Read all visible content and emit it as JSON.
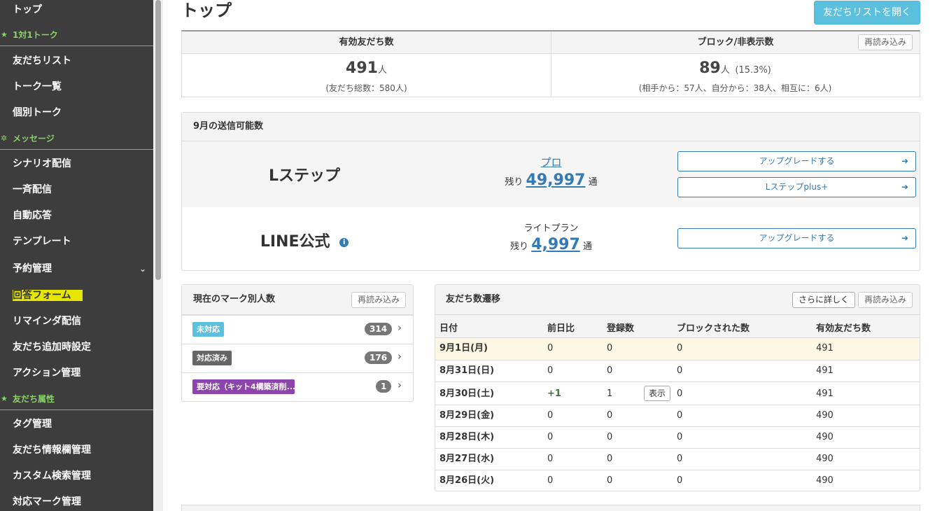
{
  "sidebar": {
    "top": "トップ",
    "sections": [
      {
        "title": "1対1トーク",
        "icon": "star-icon"
      },
      {
        "title": "メッセージ",
        "icon": "broadcast-icon"
      },
      {
        "title": "友だち属性",
        "icon": "star-icon"
      }
    ],
    "items": [
      "友だちリスト",
      "トーク一覧",
      "個別トーク",
      "シナリオ配信",
      "一斉配信",
      "自動応答",
      "テンプレート",
      "予約管理",
      "回答フォーム",
      "リマインダ配信",
      "友だち追加時設定",
      "アクション管理",
      "タグ管理",
      "友だち情報欄管理",
      "カスタム検索管理",
      "対応マーク管理"
    ],
    "active_item": "回答フォーム"
  },
  "header": {
    "title": "トップ",
    "open_friends_list": "友だちリストを開く"
  },
  "stats": {
    "valid_label": "有効友だち数",
    "valid_count": "491",
    "unit": "人",
    "valid_sub": "(友だち総数：580人)",
    "block_label": "ブロック/非表示数",
    "block_count": "89",
    "block_percent": "(15.3%)",
    "block_sub": "(相手から：57人、自分から：38人、相互に：6人)",
    "reload": "再読み込み"
  },
  "send_capacity": {
    "title": "9月の送信可能数",
    "lstep": {
      "name": "Lステップ",
      "plan": "プロ",
      "remain_prefix": "残り",
      "remain_value": "49,997",
      "remain_suffix": "通",
      "buttons": [
        "アップグレードする",
        "Lステップplus+"
      ]
    },
    "line": {
      "name": "LINE公式",
      "plan": "ライトプラン",
      "remain_prefix": "残り",
      "remain_value": "4,997",
      "remain_suffix": "通",
      "buttons": [
        "アップグレードする"
      ]
    }
  },
  "marks": {
    "title": "現在のマーク別人数",
    "reload": "再読み込み",
    "rows": [
      {
        "label": "未対応",
        "count": "314",
        "color": "#5bc0de"
      },
      {
        "label": "対応済み",
        "count": "176",
        "color": "#666666"
      },
      {
        "label": "要対応（キット4構築済削...",
        "count": "1",
        "color": "#8e44ad"
      }
    ]
  },
  "friends_trend": {
    "title": "友だち数遷移",
    "more": "さらに詳しく",
    "reload": "再読み込み",
    "headers": [
      "日付",
      "前日比",
      "登録数",
      "ブロックされた数",
      "有効友だち数"
    ],
    "view_label": "表示",
    "rows": [
      {
        "date": "9月1日(月)",
        "diff": "0",
        "reg": "0",
        "blocked": "0",
        "valid": "491"
      },
      {
        "date": "8月31日(日)",
        "diff": "0",
        "reg": "0",
        "blocked": "0",
        "valid": "491"
      },
      {
        "date": "8月30日(土)",
        "diff": "+1",
        "reg": "1",
        "blocked": "0",
        "valid": "491"
      },
      {
        "date": "8月29日(金)",
        "diff": "0",
        "reg": "0",
        "blocked": "0",
        "valid": "490"
      },
      {
        "date": "8月28日(木)",
        "diff": "0",
        "reg": "0",
        "blocked": "0",
        "valid": "490"
      },
      {
        "date": "8月27日(水)",
        "diff": "0",
        "reg": "0",
        "blocked": "0",
        "valid": "490"
      },
      {
        "date": "8月26日(火)",
        "diff": "0",
        "reg": "0",
        "blocked": "0",
        "valid": "490"
      }
    ]
  }
}
